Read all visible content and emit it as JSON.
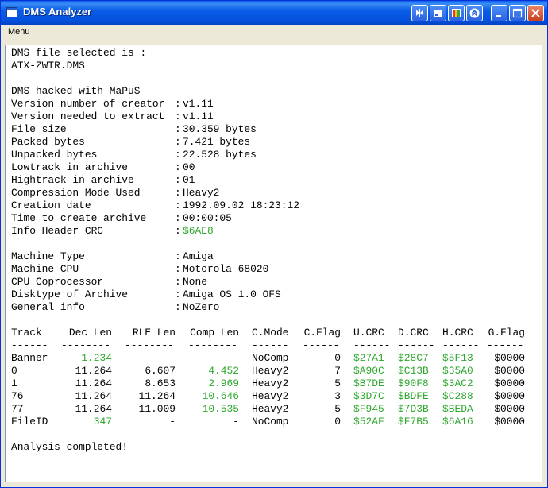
{
  "window": {
    "title": "DMS Analyzer"
  },
  "menu": {
    "label": "Menu"
  },
  "info": {
    "selected_label": "DMS file selected is :",
    "file_name": "ATX-ZWTR.DMS",
    "hacked_line": "DMS hacked with MaPuS",
    "rows": [
      {
        "label": "Version number of creator",
        "value": "v1.11",
        "green": false
      },
      {
        "label": "Version needed to extract",
        "value": "v1.11",
        "green": false
      },
      {
        "label": "File size",
        "value": "30.359 bytes",
        "green": false
      },
      {
        "label": "Packed bytes",
        "value": "7.421 bytes",
        "green": false
      },
      {
        "label": "Unpacked bytes",
        "value": "22.528 bytes",
        "green": false
      },
      {
        "label": "Lowtrack in archive",
        "value": "00",
        "green": false
      },
      {
        "label": "Hightrack in archive",
        "value": "01",
        "green": false
      },
      {
        "label": "Compression Mode Used",
        "value": "Heavy2",
        "green": false
      },
      {
        "label": "Creation date",
        "value": "1992.09.02 18:23:12",
        "green": false
      },
      {
        "label": "Time to create archive",
        "value": "00:00:05",
        "green": false
      },
      {
        "label": "Info Header CRC",
        "value": "$6AE8",
        "green": true
      }
    ],
    "machine_rows": [
      {
        "label": "Machine Type",
        "value": "Amiga"
      },
      {
        "label": "Machine CPU",
        "value": "Motorola 68020"
      },
      {
        "label": "CPU Coprocessor",
        "value": "None"
      },
      {
        "label": "Disktype of Archive",
        "value": "Amiga OS 1.0 OFS"
      },
      {
        "label": "General info",
        "value": "NoZero"
      }
    ]
  },
  "table": {
    "headers": [
      "Track",
      "Dec Len",
      "RLE Len",
      "Comp Len",
      "C.Mode",
      "C.Flag",
      "U.CRC",
      "D.CRC",
      "H.CRC",
      "G.Flag"
    ],
    "separators": [
      "------",
      "--------",
      "--------",
      "--------",
      "------",
      "------",
      "------",
      "------",
      "------",
      "------"
    ],
    "rows": [
      {
        "track": "Banner",
        "dec": "1.234",
        "dec_green": true,
        "rle": "-",
        "comp": "-",
        "comp_green": false,
        "mode": "NoComp",
        "flag": "0",
        "ucrc": "$27A1",
        "dcrc": "$28C7",
        "hcrc": "$5F13",
        "gflag": "$0000"
      },
      {
        "track": "0",
        "dec": "11.264",
        "dec_green": false,
        "rle": "6.607",
        "comp": "4.452",
        "comp_green": true,
        "mode": "Heavy2",
        "flag": "7",
        "ucrc": "$A90C",
        "dcrc": "$C13B",
        "hcrc": "$35A0",
        "gflag": "$0000"
      },
      {
        "track": "1",
        "dec": "11.264",
        "dec_green": false,
        "rle": "8.653",
        "comp": "2.969",
        "comp_green": true,
        "mode": "Heavy2",
        "flag": "5",
        "ucrc": "$B7DE",
        "dcrc": "$90F8",
        "hcrc": "$3AC2",
        "gflag": "$0000"
      },
      {
        "track": "76",
        "dec": "11.264",
        "dec_green": false,
        "rle": "11.264",
        "comp": "10.646",
        "comp_green": true,
        "mode": "Heavy2",
        "flag": "3",
        "ucrc": "$3D7C",
        "dcrc": "$BDFE",
        "hcrc": "$C288",
        "gflag": "$0000"
      },
      {
        "track": "77",
        "dec": "11.264",
        "dec_green": false,
        "rle": "11.009",
        "comp": "10.535",
        "comp_green": true,
        "mode": "Heavy2",
        "flag": "5",
        "ucrc": "$F945",
        "dcrc": "$7D3B",
        "hcrc": "$BEDA",
        "gflag": "$0000"
      },
      {
        "track": "FileID",
        "dec": "347",
        "dec_green": true,
        "rle": "-",
        "comp": "-",
        "comp_green": false,
        "mode": "NoComp",
        "flag": "0",
        "ucrc": "$52AF",
        "dcrc": "$F7B5",
        "hcrc": "$6A16",
        "gflag": "$0000"
      }
    ],
    "green_color": "#2ea82e"
  },
  "status": "Analysis completed!"
}
